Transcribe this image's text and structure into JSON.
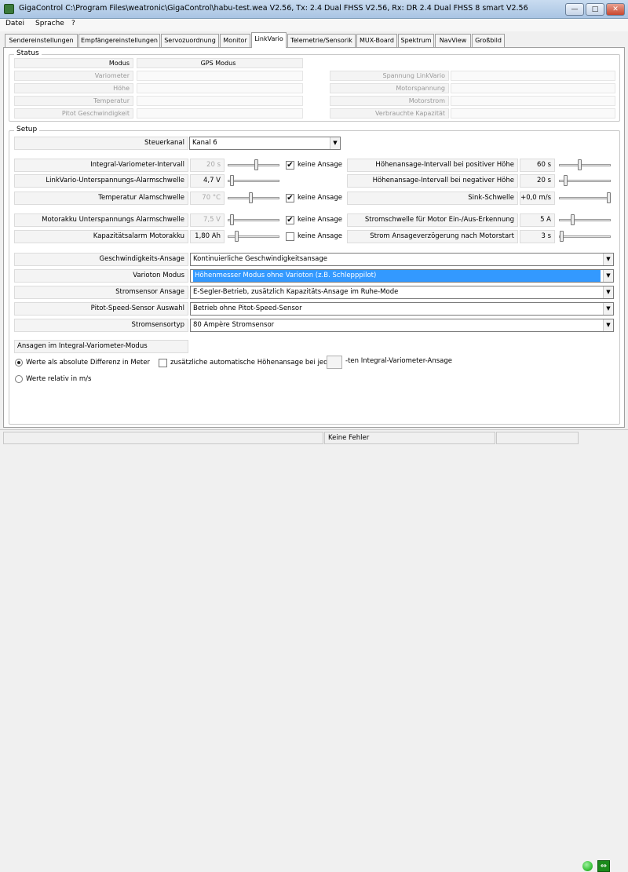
{
  "window": {
    "title": "GigaControl    C:\\Program Files\\weatronic\\GigaControl\\habu-test.wea     V2.56,    Tx: 2.4 Dual FHSS V2.56,    Rx: DR 2.4 Dual FHSS 8 smart V2.56",
    "minimize": "—",
    "maximize": "□",
    "close": "✕"
  },
  "menu": [
    "Datei",
    "Sprache",
    "?"
  ],
  "tabs": [
    "Sendereinstellungen",
    "Empfängereinstellungen",
    "Servozuordnung",
    "Monitor",
    "LinkVario",
    "Telemetrie/Sensorik",
    "MUX-Board",
    "Spektrum",
    "NavView",
    "Großbild"
  ],
  "status": {
    "legend": "Status",
    "modus_label": "Modus",
    "modus_value": "GPS Modus",
    "left": [
      "Variometer",
      "Höhe",
      "Temperatur",
      "Pitot Geschwindigkeit"
    ],
    "right": [
      "Spannung LinkVario",
      "Motorspannung",
      "Motorstrom",
      "Verbrauchte Kapazität"
    ]
  },
  "setup": {
    "legend": "Setup",
    "steuerkanal_label": "Steuerkanal",
    "steuerkanal_value": "Kanal 6",
    "rows_left": [
      {
        "label": "Integral-Variometer-Intervall",
        "value": "20 s",
        "checkbox": "keine Ansage",
        "checked": true,
        "level": 0.55
      },
      {
        "label": "LinkVario-Unterspannungs-Alarmschwelle",
        "value": "4,7 V",
        "checkbox": "",
        "checked": false,
        "level": 0.05
      },
      {
        "label": "Temperatur Alamschwelle",
        "value": "70 °C",
        "checkbox": "keine Ansage",
        "checked": true,
        "level": 0.45
      },
      {
        "label": "Motorakku Unterspannungs Alarmschwelle",
        "value": "7,5 V",
        "checkbox": "keine Ansage",
        "checked": true,
        "level": 0.05
      },
      {
        "label": "Kapazitätsalarm Motorakku",
        "value": "1,80 Ah",
        "checkbox": "keine Ansage",
        "checked": false,
        "level": 0.15
      }
    ],
    "rows_right": [
      {
        "label": "Höhenansage-Intervall bei positiver Höhe",
        "value": "60 s",
        "level": 0.4
      },
      {
        "label": "Höhenansage-Intervall bei negativer Höhe",
        "value": "20 s",
        "level": 0.1
      },
      {
        "label": "Sink-Schwelle",
        "value": "+0,0 m/s",
        "level": 1.0
      },
      {
        "label": "Stromschwelle für Motor Ein-/Aus-Erkennung",
        "value": "5 A",
        "level": 0.25
      },
      {
        "label": "Strom Ansageverzögerung nach Motorstart",
        "value": "3 s",
        "level": 0.02
      }
    ],
    "selects": [
      {
        "label": "Geschwindigkeits-Ansage",
        "value": "Kontinuierliche Geschwindigkeitsansage",
        "selected": false
      },
      {
        "label": "Varioton Modus",
        "value": "Höhenmesser Modus ohne Varioton (z.B. Schlepppilot)",
        "selected": true
      },
      {
        "label": "Stromsensor Ansage",
        "value": "E-Segler-Betrieb, zusätzlich Kapazitäts-Ansage im Ruhe-Mode",
        "selected": false
      },
      {
        "label": "Pitot-Speed-Sensor Auswahl",
        "value": "Betrieb ohne Pitot-Speed-Sensor",
        "selected": false
      },
      {
        "label": "Stromsensortyp",
        "value": "80 Ampère Stromsensor",
        "selected": false
      }
    ],
    "integral_label": "Ansagen im Integral-Variometer-Modus",
    "radio_abs": "Werte als absolute Differenz in Meter",
    "radio_rel": "Werte relativ in m/s",
    "auto_hoehe": "zusätzliche automatische Höhenansage bei jeder",
    "auto_suffix": "-ten Integral-Variometer-Ansage"
  },
  "statusbar": {
    "message": "Keine Fehler"
  },
  "colors": {
    "accent": "#3399ff",
    "led": "#3cc43c",
    "link": "#1a8a1a"
  }
}
